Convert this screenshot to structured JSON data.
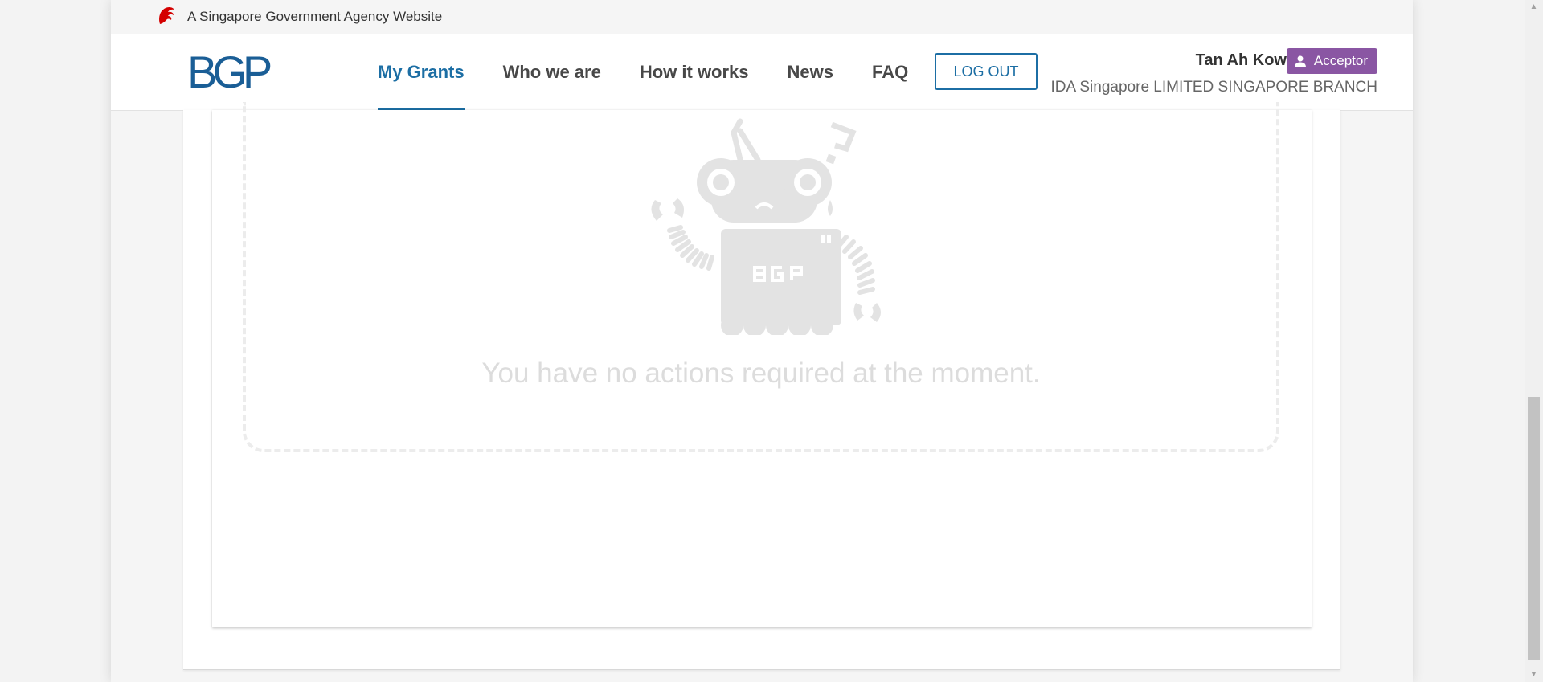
{
  "masthead": {
    "text": "A Singapore Government Agency Website",
    "icon": "lion-head-icon"
  },
  "header": {
    "logo_text": "BGP",
    "nav": [
      {
        "label": "My Grants",
        "active": true
      },
      {
        "label": "Who we are",
        "active": false
      },
      {
        "label": "How it works",
        "active": false
      },
      {
        "label": "News",
        "active": false
      },
      {
        "label": "FAQ",
        "active": false
      }
    ],
    "logout_label": "LOG OUT",
    "user_name": "Tan Ah Kow",
    "role": "Acceptor",
    "organisation": "IDA Singapore LIMITED SINGAPORE BRANCH"
  },
  "main": {
    "empty_state_message": "You have no actions required at the moment.",
    "illustration_text": "BGP",
    "illustration": "robot-icon"
  },
  "colors": {
    "brand_blue": "#1c6ea4",
    "badge_purple": "#8a56a3",
    "masthead_red": "#d40000"
  }
}
